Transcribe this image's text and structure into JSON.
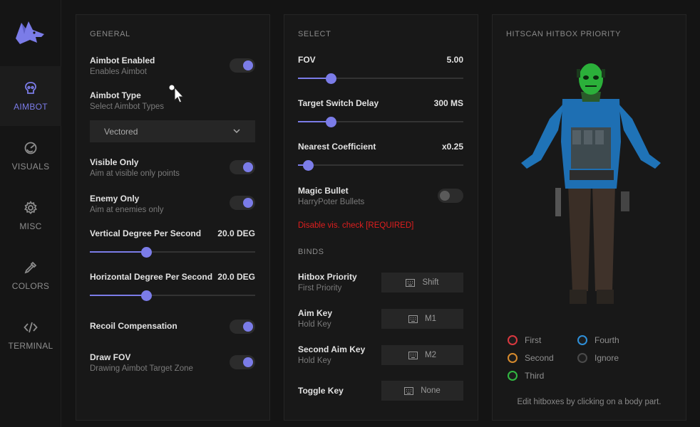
{
  "sidebar": {
    "items": [
      {
        "label": "AIMBOT",
        "icon": "skull-icon"
      },
      {
        "label": "VISUALS",
        "icon": "eye-icon"
      },
      {
        "label": "MISC",
        "icon": "gear-icon"
      },
      {
        "label": "COLORS",
        "icon": "dropper-icon"
      },
      {
        "label": "TERMINAL",
        "icon": "code-icon"
      }
    ]
  },
  "general": {
    "title": "GENERAL",
    "aimbot_enabled": {
      "label": "Aimbot Enabled",
      "sub": "Enables Aimbot",
      "on": true
    },
    "aimbot_type": {
      "label": "Aimbot Type",
      "sub": "Select Aimbot Types",
      "selected": "Vectored"
    },
    "visible_only": {
      "label": "Visible Only",
      "sub": "Aim at visible only points",
      "on": true
    },
    "enemy_only": {
      "label": "Enemy Only",
      "sub": "Aim at enemies only",
      "on": true
    },
    "vertical": {
      "label": "Vertical Degree Per Second",
      "value": "20.0 DEG",
      "fraction": 0.34
    },
    "horizontal": {
      "label": "Horizontal Degree Per Second",
      "value": "20.0 DEG",
      "fraction": 0.34
    },
    "recoil": {
      "label": "Recoil Compensation",
      "on": true
    },
    "draw_fov": {
      "label": "Draw FOV",
      "sub": "Drawing Aimbot Target Zone",
      "on": true
    }
  },
  "select": {
    "title": "SELECT",
    "fov": {
      "label": "FOV",
      "value": "5.00",
      "fraction": 0.2
    },
    "switch_delay": {
      "label": "Target Switch Delay",
      "value": "300 MS",
      "fraction": 0.2
    },
    "nearest": {
      "label": "Nearest Coefficient",
      "value": "x0.25",
      "fraction": 0.06
    },
    "magic_bullet": {
      "label": "Magic Bullet",
      "sub": "HarryPoter Bullets",
      "on": false
    },
    "warning": "Disable vis. check [REQUIRED]",
    "binds_title": "BINDS",
    "binds": [
      {
        "label": "Hitbox Priority",
        "sub": "First Priority",
        "key": "Shift"
      },
      {
        "label": "Aim Key",
        "sub": "Hold Key",
        "key": "M1"
      },
      {
        "label": "Second Aim Key",
        "sub": "Hold Key",
        "key": "M2"
      },
      {
        "label": "Toggle Key",
        "sub": "",
        "key": "None"
      }
    ]
  },
  "hitscan": {
    "title": "HITSCAN HITBOX PRIORITY",
    "legend": [
      {
        "label": "First",
        "color": "#d9383f"
      },
      {
        "label": "Fourth",
        "color": "#2e8fd8"
      },
      {
        "label": "Second",
        "color": "#d68a2d"
      },
      {
        "label": "Ignore",
        "color": "#4a4a4a"
      },
      {
        "label": "Third",
        "color": "#32b842"
      }
    ],
    "hint": "Edit hitboxes by clicking on a body part."
  },
  "colors": {
    "accent": "#7b7ce8",
    "warning": "#e01e1e"
  }
}
